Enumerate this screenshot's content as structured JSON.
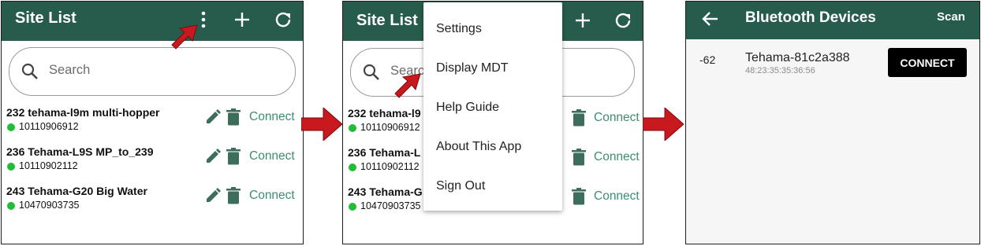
{
  "panel1": {
    "title": "Site List",
    "search_placeholder": "Search",
    "sites": [
      {
        "name": "232 tehama-l9m multi-hopper",
        "serial": "10110906912",
        "action": "Connect"
      },
      {
        "name": "236 Tehama-L9S MP_to_239",
        "serial": "10110902112",
        "action": "Connect"
      },
      {
        "name": "243 Tehama-G20 Big Water",
        "serial": "10470903735",
        "action": "Connect"
      }
    ],
    "icons": {
      "menu": "more-vert-icon",
      "add": "plus-icon",
      "refresh": "refresh-icon"
    }
  },
  "panel2": {
    "title": "Site List",
    "search_placeholder": "Search",
    "sites": [
      {
        "name": "232 tehama-l9",
        "serial": "10110906912",
        "action": "Connect"
      },
      {
        "name": "236 Tehama-L",
        "serial": "10110902112",
        "action": "Connect"
      },
      {
        "name": "243 Tehama-G",
        "serial": "10470903735",
        "action": "Connect"
      }
    ],
    "menu": [
      "Settings",
      "Display MDT",
      "Help Guide",
      "About This App",
      "Sign Out"
    ]
  },
  "panel3": {
    "title": "Bluetooth Devices",
    "scan_label": "Scan",
    "device": {
      "rssi": "-62",
      "name": "Tehama-81c2a388",
      "mac": "48:23:35:35:36:56",
      "button": "CONNECT"
    }
  },
  "colors": {
    "appbar": "#275c4c",
    "accent": "#3d8e6f",
    "status_dot": "#20bd36",
    "pointer": "#c8191e"
  }
}
